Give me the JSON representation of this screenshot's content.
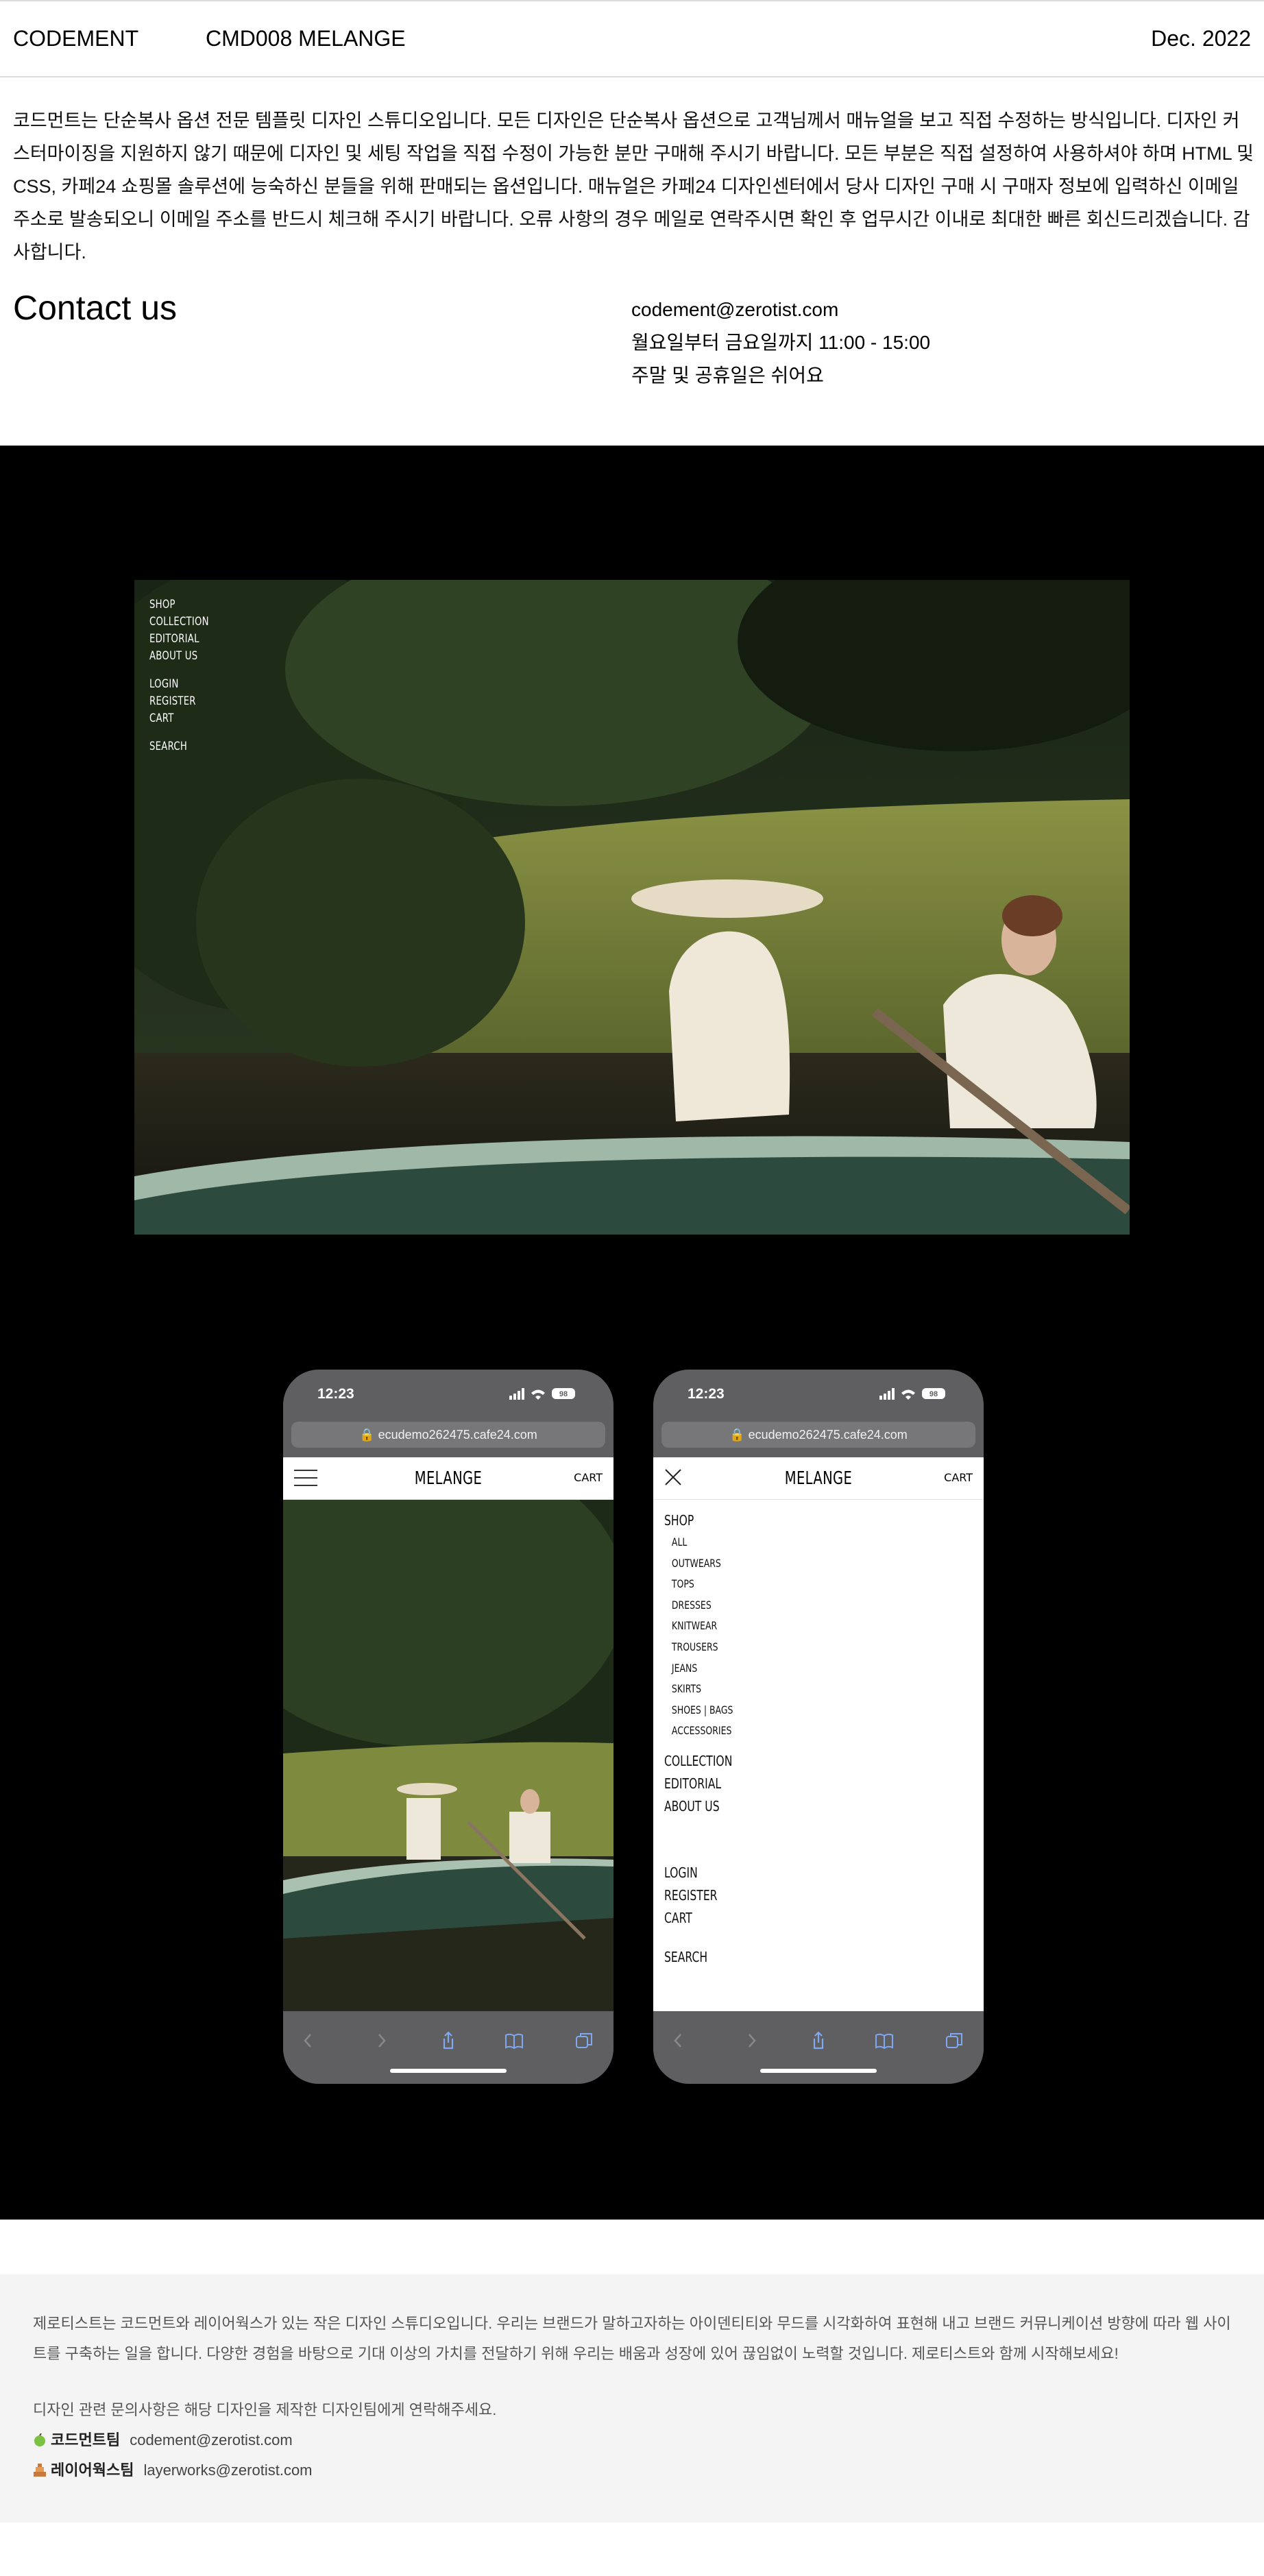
{
  "header": {
    "brand": "CODEMENT",
    "product": "CMD008 MELANGE",
    "date": "Dec. 2022"
  },
  "intro": "코드먼트는 단순복사 옵션 전문 템플릿 디자인 스튜디오입니다. 모든 디자인은 단순복사 옵션으로 고객님께서 매뉴얼을 보고 직접 수정하는 방식입니다. 디자인 커스터마이징을 지원하지 않기 때문에 디자인 및 세팅 작업을 직접 수정이 가능한 분만 구매해 주시기 바랍니다. 모든 부분은 직접 설정하여 사용하셔야 하며 HTML 및 CSS, 카페24 쇼핑몰 솔루션에 능숙하신 분들을 위해 판매되는 옵션입니다. 매뉴얼은 카페24 디자인센터에서 당사 디자인 구매 시 구매자 정보에 입력하신 이메일 주소로 발송되오니 이메일 주소를 반드시 체크해 주시기 바랍니다. 오류 사항의 경우 메일로 연락주시면 확인 후 업무시간 이내로 최대한 빠른 회신드리겠습니다. 감사합니다.",
  "contact": {
    "title": "Contact us",
    "email": "codement@zerotist.com",
    "hours": "월요일부터 금요일까지 11:00 - 15:00",
    "holiday": "주말 및 공휴일은 쉬어요"
  },
  "hero_nav": {
    "items": [
      "SHOP",
      "COLLECTION",
      "EDITORIAL",
      "ABOUT US"
    ],
    "account": [
      "LOGIN",
      "REGISTER",
      "CART"
    ],
    "search": "SEARCH"
  },
  "phone": {
    "time": "12:23",
    "battery": "98",
    "url": "ecudemo262475.cafe24.com",
    "logo": "MELANGE",
    "cart": "CART"
  },
  "mobile_menu": {
    "shop": "SHOP",
    "shop_items": [
      "ALL",
      "OUTWEARS",
      "TOPS",
      "DRESSES",
      "KNITWEAR",
      "TROUSERS",
      "JEANS",
      "SKIRTS",
      "SHOES | BAGS",
      "ACCESSORIES"
    ],
    "main": [
      "COLLECTION",
      "EDITORIAL",
      "ABOUT US"
    ],
    "account": [
      "LOGIN",
      "REGISTER",
      "CART"
    ],
    "search": "SEARCH"
  },
  "footer": {
    "about": "제로티스트는 코드먼트와 레이어웍스가 있는 작은 디자인 스튜디오입니다. 우리는 브랜드가 말하고자하는 아이덴티티와 무드를 시각화하여 표현해 내고 브랜드 커뮤니케이션 방향에 따라 웹 사이트를 구축하는 일을 합니다. 다양한 경험을 바탕으로 기대 이상의 가치를 전달하기 위해 우리는 배움과 성장에 있어 끊임없이 노력할 것입니다. 제로티스트와 함께 시작해보세요!",
    "inquiry": "디자인 관련 문의사항은 해당 디자인을 제작한 디자인팀에게 연락해주세요.",
    "team1_name": "코드먼트팀",
    "team1_email": "codement@zerotist.com",
    "team2_name": "레이어웍스팀",
    "team2_email": "layerworks@zerotist.com"
  },
  "colors": {
    "showcase_bg": "#000000",
    "footer_bg": "#f4f4f4",
    "phone_chrome": "#5f5f61"
  }
}
